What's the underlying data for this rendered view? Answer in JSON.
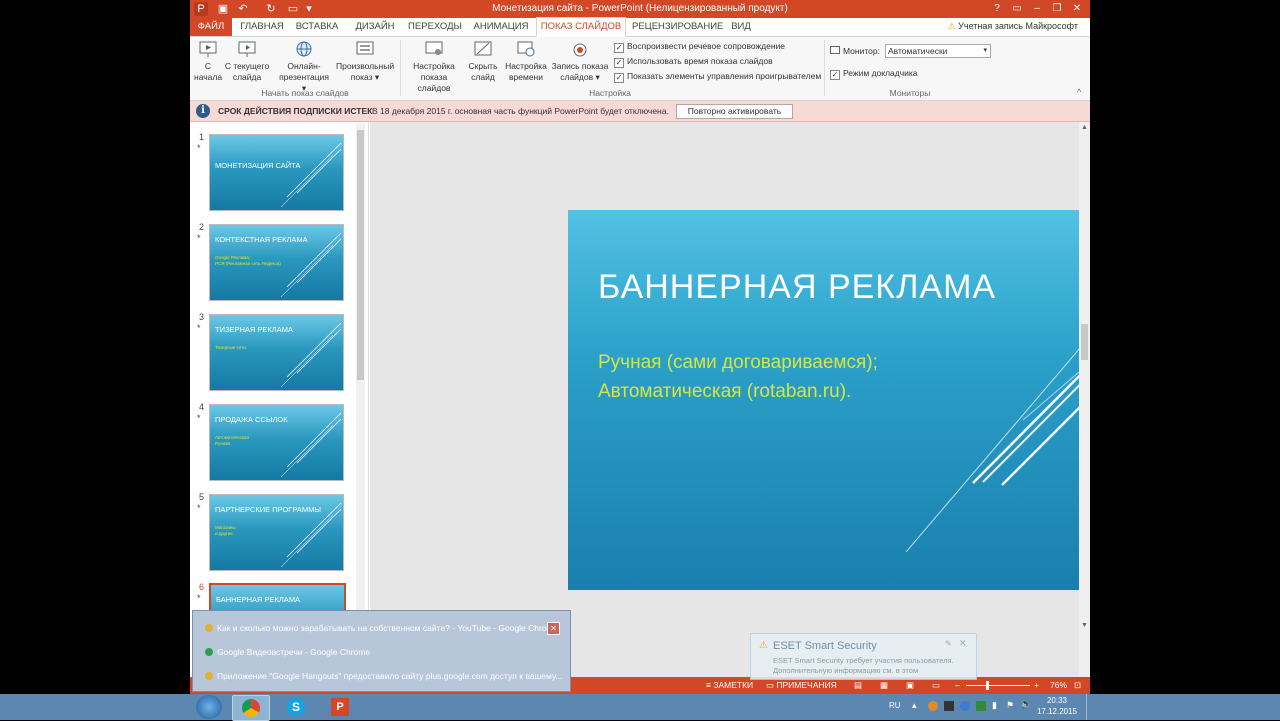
{
  "window": {
    "title": "Монетизация сайта - PowerPoint (Нелицензированный продукт)",
    "controls": [
      "?",
      "▭",
      "–",
      "❐",
      "✕"
    ]
  },
  "tabs": {
    "file": "ФАЙЛ",
    "items": [
      "ГЛАВНАЯ",
      "ВСТАВКА",
      "ДИЗАЙН",
      "ПЕРЕХОДЫ",
      "АНИМАЦИЯ",
      "ПОКАЗ СЛАЙДОВ",
      "РЕЦЕНЗИРОВАНИЕ",
      "ВИД"
    ],
    "active": "ПОКАЗ СЛАЙДОВ",
    "account": "Учетная запись Майкрософт"
  },
  "ribbon": {
    "start": {
      "group": "Начать показ слайдов",
      "from_beginning": "С начала",
      "from_current": "С текущего слайда",
      "online": "Онлайн-презентация ▾",
      "custom": "Произвольный показ ▾"
    },
    "setup": {
      "group": "Настройка",
      "setup_show": "Настройка показа слайдов",
      "hide_slide": "Скрыть слайд",
      "rehearse": "Настройка времени",
      "record": "Запись показа слайдов ▾",
      "play_narrations": "Воспроизвести речевое сопровождение",
      "use_timings": "Использовать время показа слайдов",
      "show_controls": "Показать элементы управления проигрывателем"
    },
    "monitors": {
      "group": "Мониторы",
      "monitor_label": "Монитор:",
      "monitor_value": "Автоматически",
      "presenter_view": "Режим докладчика"
    }
  },
  "notification": {
    "title": "СРОК ДЕЙСТВИЯ ПОДПИСКИ ИСТЕК",
    "text": "В 18 декабря 2015 г. основная часть функций PowerPoint будет отключена.",
    "button": "Повторно активировать"
  },
  "thumbnails": [
    {
      "num": "1",
      "title": "МОНЕТИЗАЦИЯ САЙТА",
      "subtitle": ""
    },
    {
      "num": "2",
      "title": "КОНТЕКСТНАЯ РЕКЛАМА",
      "subtitle": "Google Реклама;\nРСЯ (Рекламная сеть Яндекса)"
    },
    {
      "num": "3",
      "title": "ТИЗЕРНАЯ РЕКЛАМА",
      "subtitle": "Тизерные сети."
    },
    {
      "num": "4",
      "title": "ПРОДАЖА ССЫЛОК",
      "subtitle": "Автоматическая\nРучная"
    },
    {
      "num": "5",
      "title": "ПАРТНЕРСКИЕ ПРОГРАММЫ",
      "subtitle": "Магазины\nи другие"
    },
    {
      "num": "6",
      "title": "БАННЕРНАЯ РЕКЛАМА",
      "subtitle": ""
    }
  ],
  "slide": {
    "title": "БАННЕРНАЯ РЕКЛАМА",
    "line1": "Ручная (сами договариваемся);",
    "line2": "Автоматическая (rotaban.ru)."
  },
  "status": {
    "notes": "ЗАМЕТКИ",
    "comments": "ПРИМЕЧАНИЯ",
    "zoom": "76%"
  },
  "popup": {
    "items": [
      "Как и сколько можно зарабатывать на собственном сайте? - YouTube - Google Chrome",
      "Google Видеовстречи - Google Chrome",
      "Приложение \"Google Hangouts\" предоставило сайту plus.google.com доступ к вашему..."
    ]
  },
  "eset": {
    "title": "ESET Smart Security",
    "text": "ESET Smart Security требует участия пользователя. Дополнительную информацию см. в этом"
  },
  "taskbar": {
    "lang": "RU",
    "time": "20:33",
    "date": "17.12.2015"
  }
}
